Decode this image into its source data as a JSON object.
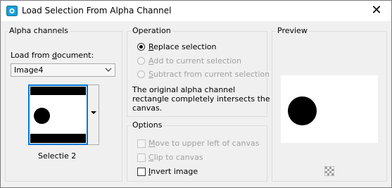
{
  "window": {
    "title": "Load Selection From Alpha Channel"
  },
  "alpha_channels": {
    "title": "Alpha channels",
    "load_from_document_label": "Load from document:",
    "document_select_value": "Image4",
    "thumbnail_caption": "Selectie 2"
  },
  "operation": {
    "title": "Operation",
    "options": [
      {
        "label": "Replace selection",
        "selected": true,
        "enabled": true
      },
      {
        "label": "Add to current selection",
        "selected": false,
        "enabled": false
      },
      {
        "label": "Subtract from current selection",
        "selected": false,
        "enabled": false
      }
    ],
    "info_text": [
      "The original alpha channel",
      "rectangle completely intersects the",
      "canvas."
    ]
  },
  "options": {
    "title": "Options",
    "items": [
      {
        "label": "Move to upper left of canvas",
        "checked": false,
        "enabled": false
      },
      {
        "label": "Clip to canvas",
        "checked": false,
        "enabled": false
      },
      {
        "label": "Invert image",
        "checked": false,
        "enabled": true
      }
    ]
  },
  "preview": {
    "title": "Preview"
  },
  "icons": {
    "app": "app-icon",
    "close": "close-icon",
    "grid": "checkerboard-icon"
  }
}
